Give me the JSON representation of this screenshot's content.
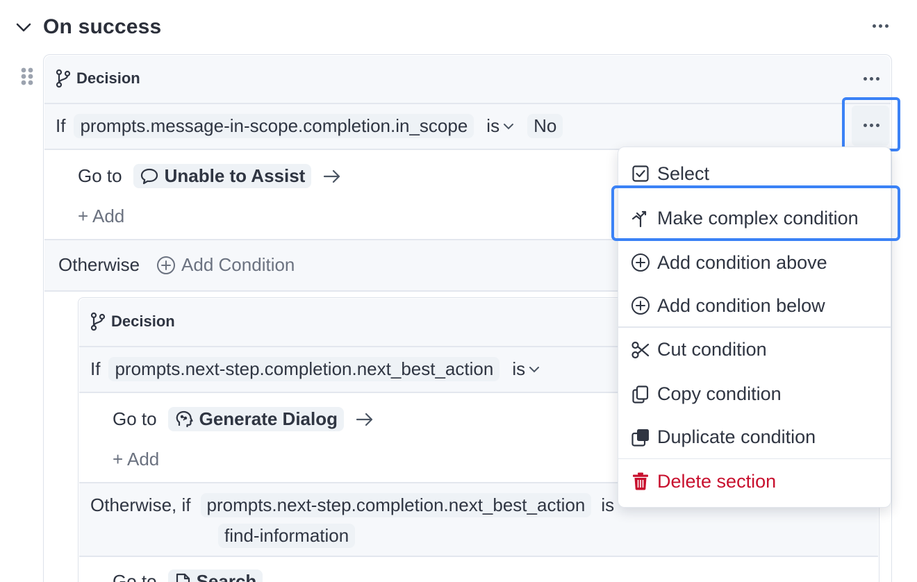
{
  "section": {
    "title": "On success"
  },
  "decision1": {
    "label": "Decision",
    "if_label": "If",
    "condition": "prompts.message-in-scope.completion.in_scope",
    "operator": "is",
    "value": "No",
    "goto_label": "Go to",
    "goto_target": "Unable to Assist",
    "add_label": "+ Add",
    "otherwise_label": "Otherwise",
    "add_condition_label": "Add Condition"
  },
  "decision2": {
    "label": "Decision",
    "if_label": "If",
    "condition": "prompts.next-step.completion.next_best_action",
    "operator": "is",
    "goto_label": "Go to",
    "goto_target": "Generate Dialog",
    "add_label": "+ Add",
    "otherwise_if_label": "Otherwise, if",
    "condition2": "prompts.next-step.completion.next_best_action",
    "operator2": "is",
    "value2": "find-information",
    "goto2_label": "Go to",
    "goto2_target": "Search"
  },
  "menu": {
    "items": [
      {
        "label": "Select",
        "icon": "checkbox-icon"
      },
      {
        "label": "Make complex condition",
        "icon": "branch-merge-icon"
      },
      {
        "label": "Add condition above",
        "icon": "plus-circle-icon"
      },
      {
        "label": "Add condition below",
        "icon": "plus-circle-icon"
      },
      {
        "label": "Cut condition",
        "icon": "scissors-icon"
      },
      {
        "label": "Copy condition",
        "icon": "copy-icon"
      },
      {
        "label": "Duplicate condition",
        "icon": "duplicate-icon"
      },
      {
        "label": "Delete section",
        "icon": "trash-icon"
      }
    ]
  },
  "colors": {
    "accent": "#3b82f6",
    "danger": "#c8102e",
    "band": "#f6f8fb",
    "chip": "#eef2f6"
  }
}
